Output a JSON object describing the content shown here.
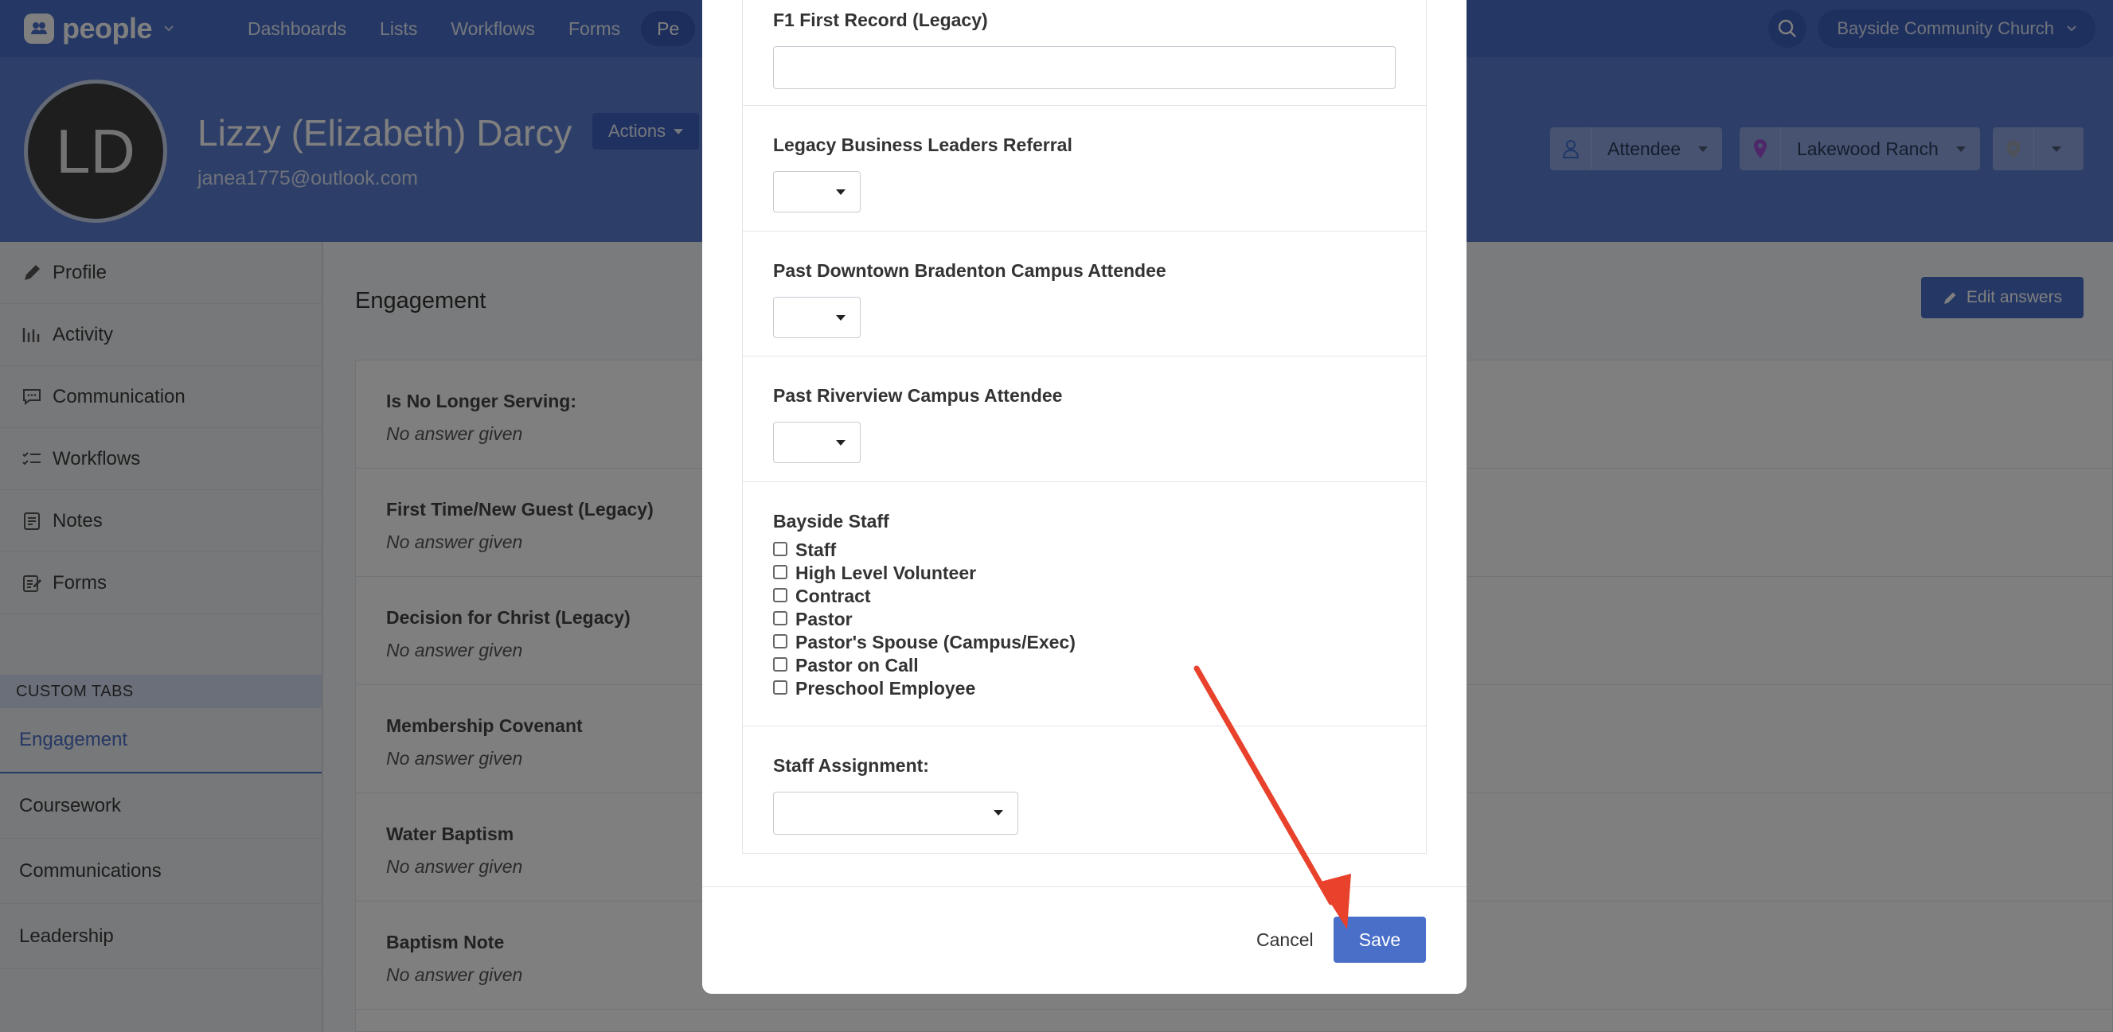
{
  "app": {
    "name": "people"
  },
  "nav": {
    "links": [
      "Dashboards",
      "Lists",
      "Workflows",
      "Forms"
    ],
    "active_partial": "Pe",
    "org": "Bayside Community Church"
  },
  "person": {
    "initials": "LD",
    "name": "Lizzy (Elizabeth) Darcy",
    "email": "janea1775@outlook.com",
    "actions_label": "Actions",
    "membership": "Attendee",
    "campus": "Lakewood Ranch"
  },
  "sidebar": {
    "items": [
      {
        "label": "Profile",
        "icon": "pencil-icon"
      },
      {
        "label": "Activity",
        "icon": "activity-bars-icon"
      },
      {
        "label": "Communication",
        "icon": "chat-bubble-icon"
      },
      {
        "label": "Workflows",
        "icon": "checklist-icon"
      },
      {
        "label": "Notes",
        "icon": "note-icon"
      },
      {
        "label": "Forms",
        "icon": "form-edit-icon"
      }
    ],
    "custom_tabs_heading": "CUSTOM TABS",
    "custom_tabs": [
      "Engagement",
      "Coursework",
      "Communications",
      "Leadership"
    ]
  },
  "main": {
    "title": "Engagement",
    "edit_label": "Edit answers",
    "answers": [
      {
        "question": "Is No Longer Serving:",
        "answer": "No answer given"
      },
      {
        "question": "First Time/New Guest (Legacy)",
        "answer": "No answer given"
      },
      {
        "question": "Decision for Christ (Legacy)",
        "answer": "No answer given"
      },
      {
        "question": "Membership Covenant",
        "answer": "No answer given"
      },
      {
        "question": "Water Baptism",
        "answer": "No answer given"
      },
      {
        "question": "Baptism Note",
        "answer": "No answer given"
      }
    ]
  },
  "modal": {
    "fields": {
      "f1_first_record": "F1 First Record (Legacy)",
      "legacy_business_leaders": "Legacy Business Leaders Referral",
      "past_downtown": "Past Downtown Bradenton Campus Attendee",
      "past_riverview": "Past Riverview Campus Attendee",
      "bayside_staff": "Bayside Staff",
      "staff_assignment": "Staff Assignment:"
    },
    "staff_options": [
      "Staff",
      "High Level Volunteer",
      "Contract",
      "Pastor",
      "Pastor's Spouse (Campus/Exec)",
      "Pastor on Call",
      "Preschool Employee"
    ],
    "cancel_label": "Cancel",
    "save_label": "Save"
  },
  "colors": {
    "primary": "#4a6fc9",
    "annotation_arrow": "#e8412c"
  }
}
